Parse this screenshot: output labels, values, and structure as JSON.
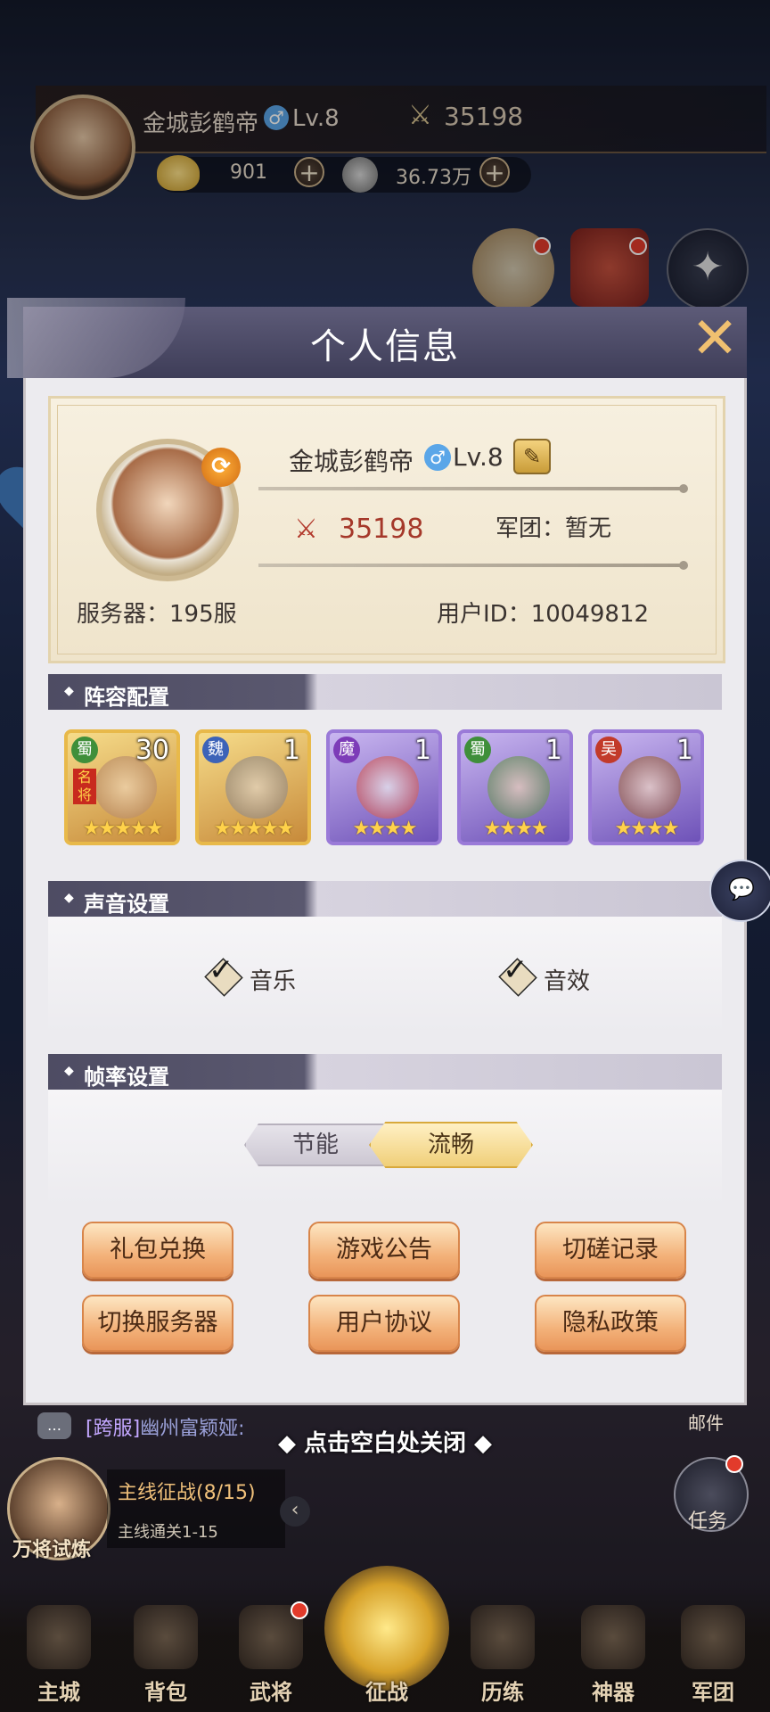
{
  "hud": {
    "player_name": "金城彭鹤帝",
    "gender_symbol": "♂",
    "level": "Lv.8",
    "power": "35198",
    "gold": "901",
    "silver": "36.73万"
  },
  "panel": {
    "title": "个人信息",
    "close_symbol": "✕",
    "player_name": "金城彭鹤帝",
    "gender_symbol": "♂",
    "level": "Lv.8",
    "edit_symbol": "✎",
    "power": "35198",
    "legion": "军团：暂无",
    "server": "服务器：195服",
    "user_id": "用户ID：10049812"
  },
  "lineup": {
    "title": "阵容配置",
    "heroes": [
      {
        "faction": "蜀",
        "count": "30",
        "stars": "★★★★★",
        "tag": "名将",
        "faction_color": "#3f8f3a"
      },
      {
        "faction": "魏",
        "count": "1",
        "stars": "★★★★★",
        "faction_color": "#3c63b8"
      },
      {
        "faction": "魔",
        "count": "1",
        "stars": "★★★★",
        "faction_color": "#7d3cb8"
      },
      {
        "faction": "蜀",
        "count": "1",
        "stars": "★★★★",
        "faction_color": "#3f8f3a"
      },
      {
        "faction": "吴",
        "count": "1",
        "stars": "★★★★",
        "faction_color": "#c23a2a"
      }
    ]
  },
  "sound": {
    "title": "声音设置",
    "music_label": "音乐",
    "effect_label": "音效",
    "music_checked": true,
    "effect_checked": true
  },
  "framerate": {
    "title": "帧率设置",
    "option_power_save": "节能",
    "option_smooth": "流畅",
    "selected": "流畅"
  },
  "buttons": {
    "gift_redeem": "礼包兑换",
    "announcement": "游戏公告",
    "duel_record": "切磋记录",
    "switch_server": "切换服务器",
    "user_agreement": "用户协议",
    "privacy_policy": "隐私政策"
  },
  "bottom": {
    "close_hint": "点击空白处关闭",
    "chat_tag": "[跨服]",
    "chat_name": "幽州富颖娅:",
    "mail_label": "邮件",
    "task_label": "任务",
    "quest_avatar_label": "万将试炼",
    "quest_title": "主线征战(8/15)",
    "quest_sub": "主线通关1-15",
    "nav": [
      "主城",
      "背包",
      "武将",
      "征战",
      "历练",
      "神器",
      "军团"
    ]
  }
}
